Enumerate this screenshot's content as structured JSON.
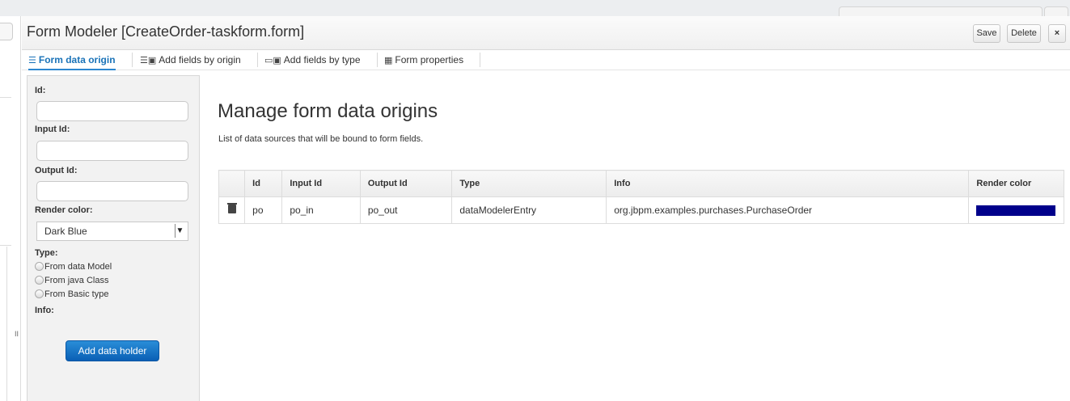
{
  "header": {
    "title": "Form Modeler [CreateOrder-taskform.form]",
    "save_label": "Save",
    "delete_label": "Delete",
    "close_label": "×"
  },
  "tabs": [
    {
      "label": "Form data origin",
      "icon": "database-icon",
      "active": true
    },
    {
      "label": "Add fields by origin",
      "icon": "fields-origin-icon",
      "active": false
    },
    {
      "label": "Add fields by type",
      "icon": "fields-type-icon",
      "active": false
    },
    {
      "label": "Form properties",
      "icon": "properties-icon",
      "active": false
    }
  ],
  "sidebar": {
    "id_label": "Id:",
    "id_value": "",
    "input_id_label": "Input Id:",
    "input_id_value": "",
    "output_id_label": "Output Id:",
    "output_id_value": "",
    "render_color_label": "Render color:",
    "render_color_value": "Dark Blue",
    "type_label": "Type:",
    "type_options": [
      "From data Model",
      "From java Class",
      "From Basic type"
    ],
    "info_label": "Info:",
    "add_button_label": "Add data holder"
  },
  "main": {
    "title": "Manage form data origins",
    "description": "List of data sources that will be bound to form fields."
  },
  "table": {
    "columns": [
      "",
      "Id",
      "Input Id",
      "Output Id",
      "Type",
      "Info",
      "Render color"
    ],
    "rows": [
      {
        "id": "po",
        "input_id": "po_in",
        "output_id": "po_out",
        "type": "dataModelerEntry",
        "info": "org.jbpm.examples.purchases.PurchaseOrder",
        "render_color": "#00008b"
      }
    ]
  },
  "gutter": {
    "mark": "II"
  }
}
